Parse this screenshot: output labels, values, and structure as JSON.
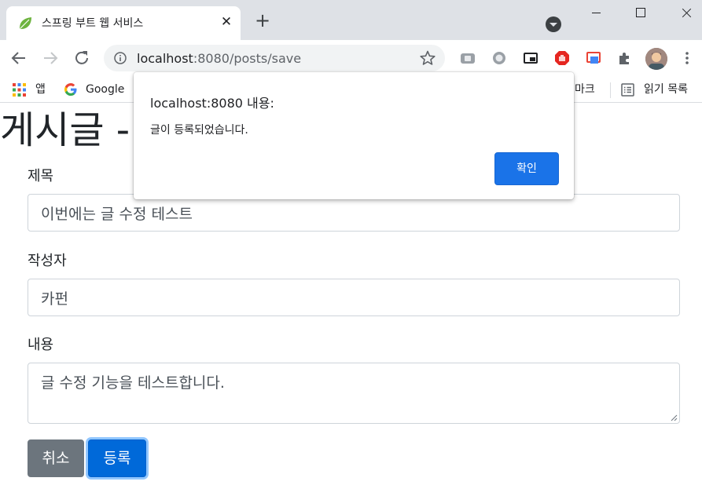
{
  "browser": {
    "tab": {
      "title": "스프링 부트 웹 서비스",
      "favicon": "spring-leaf-icon"
    },
    "url": {
      "host": "localhost",
      "rest": ":8080/posts/save"
    },
    "bookmarks": {
      "apps_label": "앱",
      "google_label": "Google",
      "partial_label": "마크",
      "reading_list_label": "읽기 목록"
    }
  },
  "page": {
    "heading": "게시글 -",
    "fields": {
      "title_label": "제목",
      "title_value": "이번에는 글 수정 테스트",
      "author_label": "작성자",
      "author_value": "카펀",
      "content_label": "내용",
      "content_value": "글 수정 기능을 테스트합니다."
    },
    "buttons": {
      "cancel": "취소",
      "submit": "등록"
    }
  },
  "dialog": {
    "title": "localhost:8080 내용:",
    "message": "글이 등록되었습니다.",
    "ok": "확인"
  },
  "colors": {
    "primary": "#0069d9",
    "secondary": "#6c757d",
    "dialog_button": "#1a73e8",
    "tabstrip": "#dee1e6"
  }
}
